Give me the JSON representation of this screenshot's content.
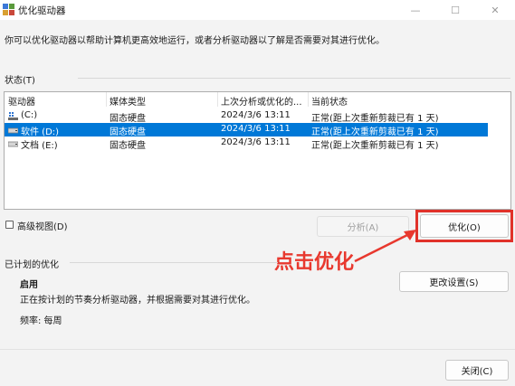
{
  "window": {
    "title": "优化驱动器",
    "icon": "defrag-app-icon"
  },
  "controls": {
    "minimize": "—",
    "maximize": "☐",
    "close": "✕"
  },
  "description": "你可以优化驱动器以帮助计算机更高效地运行，或者分析驱动器以了解是否需要对其进行优化。",
  "status_section": {
    "label": "状态(T)"
  },
  "drives": {
    "columns": [
      "驱动器",
      "媒体类型",
      "上次分析或优化的...",
      "当前状态"
    ],
    "rows": [
      {
        "name": "(C:)",
        "media": "固态硬盘",
        "last": "2024/3/6 13:11",
        "status": "正常(距上次重新剪裁已有 1 天)",
        "icon": "system-drive-icon"
      },
      {
        "name": "软件 (D:)",
        "media": "固态硬盘",
        "last": "2024/3/6 13:11",
        "status": "正常(距上次重新剪裁已有 1 天)",
        "icon": "drive-icon"
      },
      {
        "name": "文档 (E:)",
        "media": "固态硬盘",
        "last": "2024/3/6 13:11",
        "status": "正常(距上次重新剪裁已有 1 天)",
        "icon": "drive-icon"
      }
    ],
    "selected_index": 1
  },
  "advanced_view": {
    "label": "高级视图(D)",
    "checked": false
  },
  "buttons": {
    "analyze": "分析(A)",
    "optimize": "优化(O)",
    "change_settings": "更改设置(S)",
    "close": "关闭(C)"
  },
  "scheduled": {
    "label": "已计划的优化",
    "state": "启用",
    "description": "正在按计划的节奏分析驱动器，并根据需要对其进行优化。",
    "frequency": "频率: 每周"
  },
  "annotation": {
    "text": "点击优化",
    "color": "#e8382e"
  },
  "colors": {
    "selection": "#0078d7",
    "highlight": "#e0322a"
  }
}
